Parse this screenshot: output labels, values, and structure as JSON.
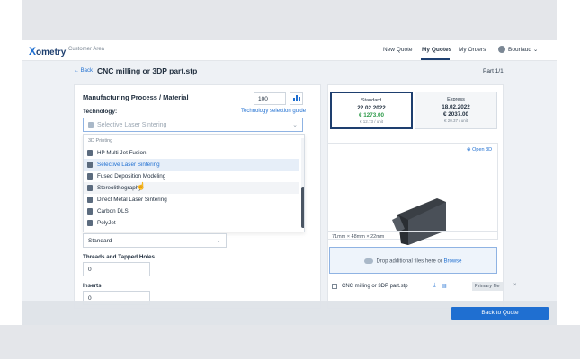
{
  "nav": {
    "logo_x": "X",
    "logo_rest": "ometry",
    "area": "Customer Area",
    "links": [
      "New Quote",
      "My Quotes",
      "My Orders"
    ],
    "user": "Bouriaud",
    "user_chev": "⌄"
  },
  "header": {
    "back": "← Back",
    "title": "CNC milling or 3DP part.stp",
    "part": "Part 1/1"
  },
  "left": {
    "section_title": "Manufacturing Process / Material",
    "quantity": "100",
    "technology_label": "Technology:",
    "technology_guide": "Technology selection guide",
    "technology_value": "Selective Laser Sintering",
    "dropdown": {
      "group": "3D Printing",
      "items": [
        "HP Multi Jet Fusion",
        "Selective Laser Sintering",
        "Fused Deposition Modeling",
        "Stereolithography",
        "Direct Metal Laser Sintering",
        "Carbon DLS",
        "PolyJet"
      ]
    },
    "finish_value": "Standard",
    "threads_label": "Threads and Tapped Holes",
    "threads_value": "0",
    "inserts_label": "Inserts",
    "inserts_value": "0"
  },
  "pricing": [
    {
      "type": "Standard",
      "date": "22.02.2022",
      "price": "€ 1273.00",
      "unit": "€ 12.73 / unit",
      "color": "#2e9b4a"
    },
    {
      "type": "Express",
      "date": "18.02.2022",
      "price": "€ 2037.00",
      "unit": "€ 20.37 / unit",
      "color": "#1f2d3d"
    }
  ],
  "viewer": {
    "open3d": "Open 3D",
    "dims": "71mm × 48mm × 22mm"
  },
  "upload": {
    "text": "Drop additional files here or ",
    "browse": "Browse"
  },
  "file": {
    "name": "CNC milling or 3DP part.stp",
    "badge": "Primary file",
    "close": "×"
  },
  "footer": {
    "button": "Back to Quote"
  },
  "icons": {
    "chevron": "⌄",
    "download": "⤓",
    "doc": "▤",
    "open3d": "⊕",
    "cursor": "☝"
  },
  "colors": {
    "accent": "#1f6fd1",
    "navy": "#1e3f6f",
    "green": "#2e9b4a"
  }
}
